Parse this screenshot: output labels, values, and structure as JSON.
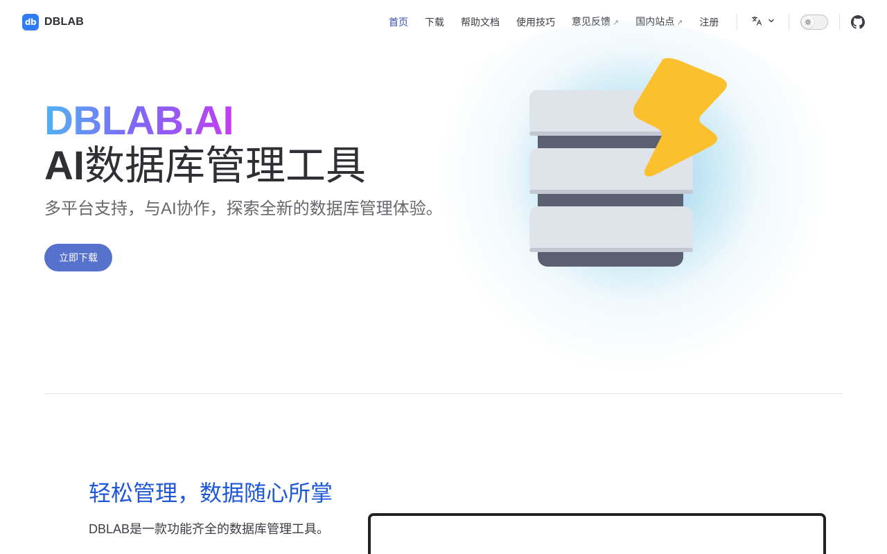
{
  "brand": {
    "logo_mark": "db",
    "name": "DBLAB"
  },
  "nav": {
    "links": [
      {
        "label": "首页",
        "active": true,
        "external": false
      },
      {
        "label": "下载",
        "active": false,
        "external": false
      },
      {
        "label": "帮助文档",
        "active": false,
        "external": false
      },
      {
        "label": "使用技巧",
        "active": false,
        "external": false
      },
      {
        "label": "意见反馈",
        "active": false,
        "external": true
      },
      {
        "label": "国内站点",
        "active": false,
        "external": true
      },
      {
        "label": "注册",
        "active": false,
        "external": false
      }
    ],
    "external_arrow": "↗",
    "language_icon": "translate-icon",
    "theme_icon": "sun-icon",
    "github_icon": "github-icon"
  },
  "hero": {
    "name": "DBLAB.AI",
    "text_bold": "AI",
    "text_rest": "数据库管理工具",
    "tagline": "多平台支持，与AI协作，探索全新的数据库管理体验。",
    "action_label": "立即下载"
  },
  "feature": {
    "title": "轻松管理，数据随心所掌",
    "description": "DBLAB是一款功能齐全的数据库管理工具。"
  },
  "colors": {
    "brand": "#2f7cf6",
    "active_link": "#3451b2",
    "button": "#5672cd",
    "feature_title": "#1f58d6",
    "bolt": "#fbc02d"
  }
}
